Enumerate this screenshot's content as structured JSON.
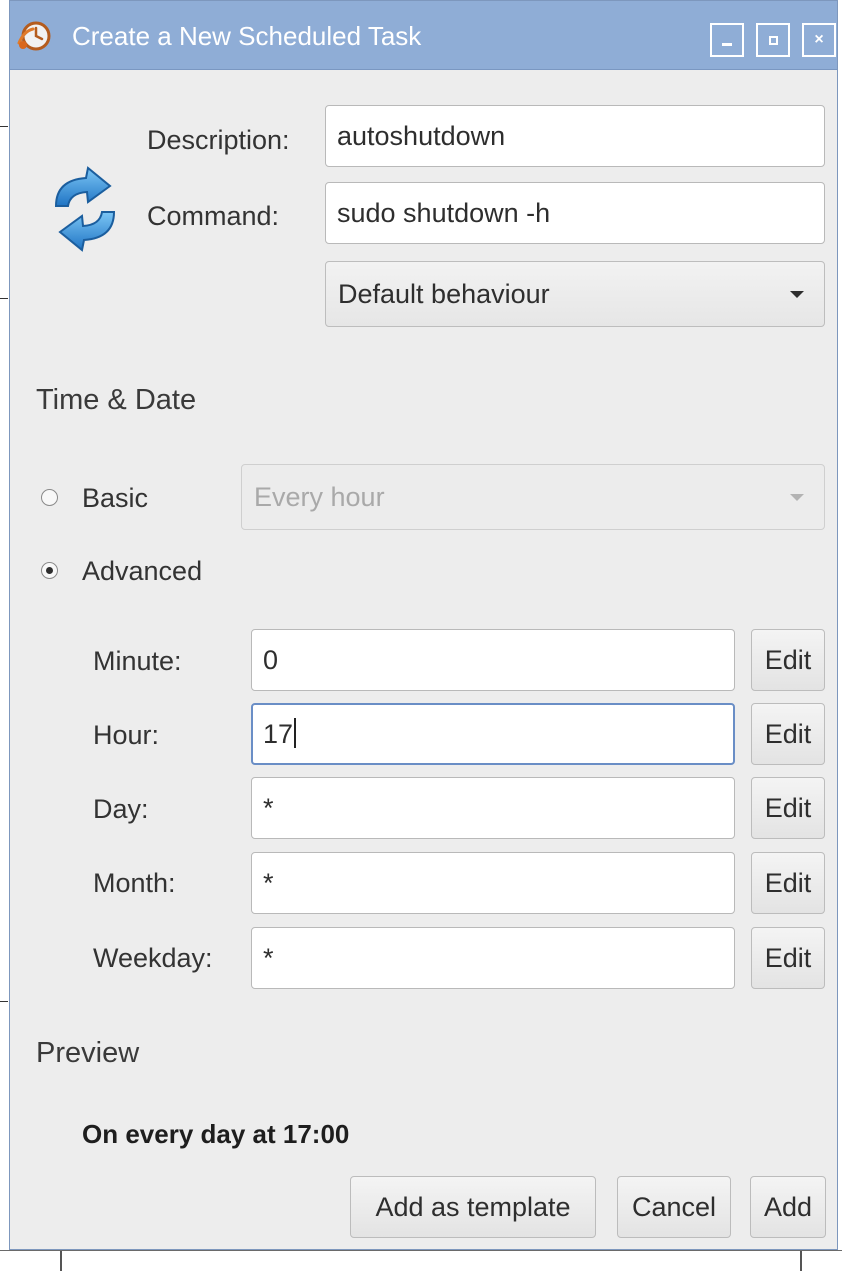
{
  "window": {
    "title": "Create a New Scheduled Task",
    "controls": [
      "minimize",
      "maximize",
      "close"
    ],
    "icon": "scheduled-task-clock-icon"
  },
  "task": {
    "icon": "refresh-arrows-icon",
    "description_label": "Description:",
    "description_value": "autoshutdown",
    "command_label": "Command:",
    "command_value": "sudo shutdown -h",
    "behaviour_selected": "Default behaviour"
  },
  "time_date": {
    "heading": "Time & Date",
    "basic_label": "Basic",
    "basic_selected_option": "Every hour",
    "basic_checked": false,
    "advanced_label": "Advanced",
    "advanced_checked": true,
    "edit_label": "Edit",
    "fields": [
      {
        "label": "Minute:",
        "value": "0"
      },
      {
        "label": "Hour:",
        "value": "17"
      },
      {
        "label": "Day:",
        "value": "*"
      },
      {
        "label": "Month:",
        "value": "*"
      },
      {
        "label": "Weekday:",
        "value": "*"
      }
    ]
  },
  "preview": {
    "heading": "Preview",
    "text": "On every day at 17:00"
  },
  "buttons": {
    "add_template": "Add as template",
    "cancel": "Cancel",
    "add": "Add"
  },
  "colors": {
    "titlebar": "#8fadd6",
    "window_bg": "#ededed",
    "focus_border": "#6a8ec6",
    "icon_blue": "#2f8fd8"
  }
}
